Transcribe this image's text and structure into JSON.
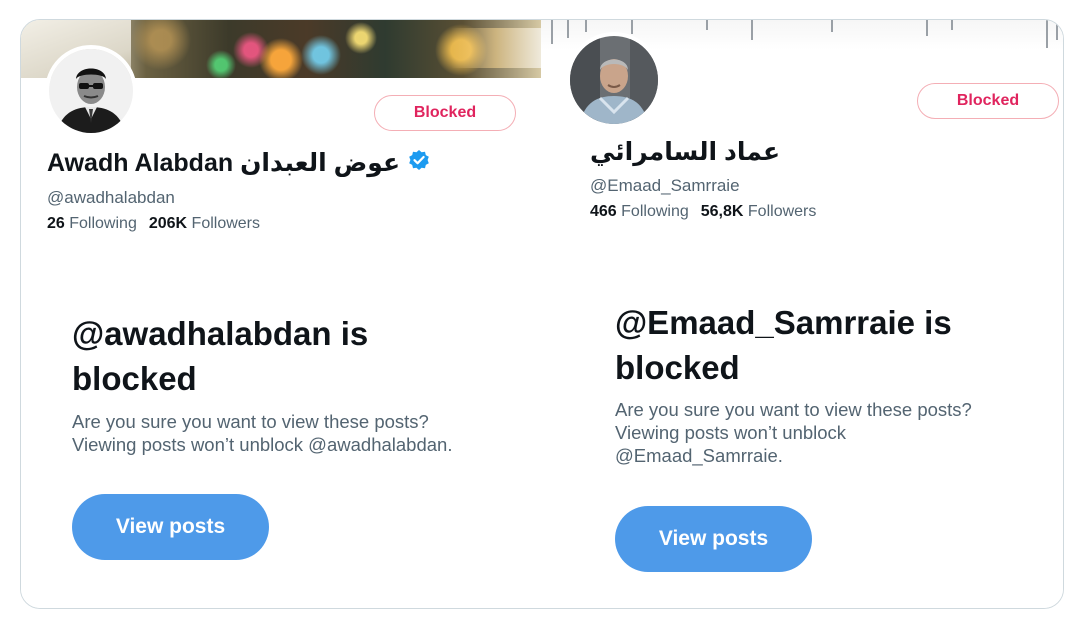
{
  "profiles": [
    {
      "display_name": "Awadh Alabdan عوض العبدان",
      "verified": true,
      "handle": "@awadhalabdan",
      "following_count": "26",
      "following_label": "Following",
      "followers_count": "206K",
      "followers_label": "Followers",
      "blocked_label": "Blocked",
      "block_title": "@awadhalabdan is blocked",
      "block_desc_line1": "Are you sure you want to view these posts?",
      "block_desc_line2": "Viewing posts won’t unblock @awadhalabdan.",
      "view_button": "View posts"
    },
    {
      "display_name": "عماد السامرائي",
      "verified": false,
      "handle": "@Emaad_Samrraie",
      "following_count": "466",
      "following_label": "Following",
      "followers_count": "56,8K",
      "followers_label": "Followers",
      "blocked_label": "Blocked",
      "block_title": "@Emaad_Samrraie is blocked",
      "block_desc_line1": "Are you sure you want to view these posts?",
      "block_desc_line2": "Viewing posts won’t unblock",
      "block_desc_line3": "@Emaad_Samrraie.",
      "view_button": "View posts"
    }
  ],
  "colors": {
    "accent_blue": "#4e9ae9",
    "blocked_red": "#e0245e",
    "verified_blue": "#1d9bf0",
    "muted_text": "#536471"
  },
  "icons": {
    "verified": "verified-badge-icon"
  }
}
